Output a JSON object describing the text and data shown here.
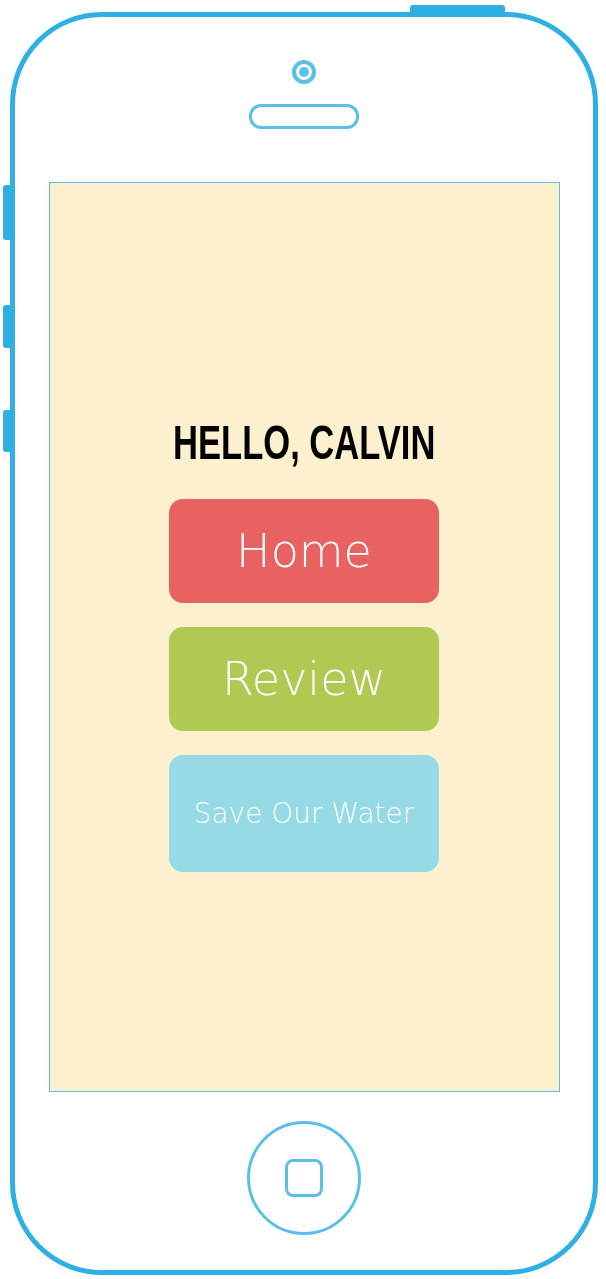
{
  "greeting": "HELLO, CALVIN",
  "buttons": [
    {
      "label": "Home",
      "color": "#e86262"
    },
    {
      "label": "Review",
      "color": "#b0c952"
    },
    {
      "label": "Save Our Water",
      "color": "#96dae6"
    }
  ]
}
